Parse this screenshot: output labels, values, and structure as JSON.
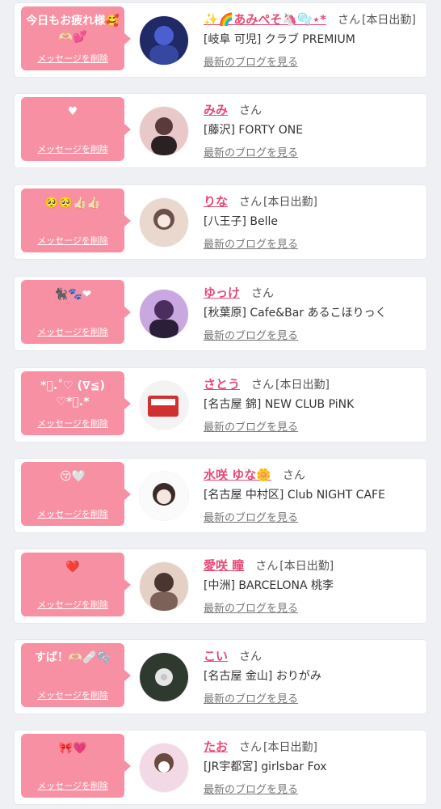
{
  "items": [
    {
      "message": "今日もお疲れ様🥰🫶🏻💕",
      "delete_label": "メッセージを削除",
      "name": "✨🌈あみぺそ🦄🫧⋆*",
      "san": "さん",
      "attendance": "[本日出勤]",
      "shop": "[岐阜 可児] クラブ PREMIUM",
      "blog_label": "最新のブログを見る",
      "avatar_colors": [
        "#1f2a66",
        "#4b5fd0"
      ]
    },
    {
      "message": "♥",
      "delete_label": "メッセージを削除",
      "name": "みみ",
      "san": "さん",
      "attendance": "",
      "shop": "[藤沢] FORTY ONE",
      "blog_label": "最新のブログを見る",
      "avatar_colors": [
        "#5a3a3a",
        "#e8c8c8"
      ]
    },
    {
      "message": "🥺🥺👍🏻👍🏻",
      "delete_label": "メッセージを削除",
      "name": "りな",
      "san": "さん",
      "attendance": "[本日出勤]",
      "shop": "[八王子] Belle",
      "blog_label": "最新のブログを見る",
      "avatar_colors": [
        "#6a5048",
        "#ead8cf"
      ]
    },
    {
      "message": "🐈‍⬛🐾❤",
      "delete_label": "メッセージを削除",
      "name": "ゆっけ",
      "san": "さん",
      "attendance": "",
      "shop": "[秋葉原] Cafe&Bar あるこほりっく",
      "blog_label": "最新のブログを見る",
      "avatar_colors": [
        "#4b2e5d",
        "#c9a7e0"
      ]
    },
    {
      "message": "*ﾟ.˚♡ (∇≦) ♡*ﾟ.*",
      "delete_label": "メッセージを削除",
      "name": "さとう",
      "san": "さん",
      "attendance": "[本日出勤]",
      "shop": "[名古屋 錦] NEW CLUB PiNK",
      "blog_label": "最新のブログを見る",
      "avatar_colors": [
        "#f3f3f3",
        "#d03030"
      ]
    },
    {
      "message": "😚🤍",
      "delete_label": "メッセージを削除",
      "name": "水咲 ゆな🌼",
      "san": "さん",
      "attendance": "",
      "shop": "[名古屋 中村区] Club NIGHT CAFE",
      "blog_label": "最新のブログを見る",
      "avatar_colors": [
        "#fafafa",
        "#3a2a2a"
      ]
    },
    {
      "message": "❤️",
      "delete_label": "メッセージを削除",
      "name": "愛咲 瞳",
      "san": "さん",
      "attendance": "[本日出勤]",
      "shop": "[中洲] BARCELONA 桃李",
      "blog_label": "最新のブログを見る",
      "avatar_colors": [
        "#4a3530",
        "#e5d0c6"
      ]
    },
    {
      "message": "すば！🫶🏻🩹🫧",
      "delete_label": "メッセージを削除",
      "name": "こい",
      "san": "さん",
      "attendance": "",
      "shop": "[名古屋 金山] おりがみ",
      "blog_label": "最新のブログを見る",
      "avatar_colors": [
        "#2f3a2f",
        "#e6e6e6"
      ]
    },
    {
      "message": "🎀💗",
      "delete_label": "メッセージを削除",
      "name": "たお",
      "san": "さん",
      "attendance": "[本日出勤]",
      "shop": "[JR宇都宮] girlsbar Fox",
      "blog_label": "最新のブログを見る",
      "avatar_colors": [
        "#6a4a3f",
        "#f3d8e5"
      ]
    }
  ]
}
